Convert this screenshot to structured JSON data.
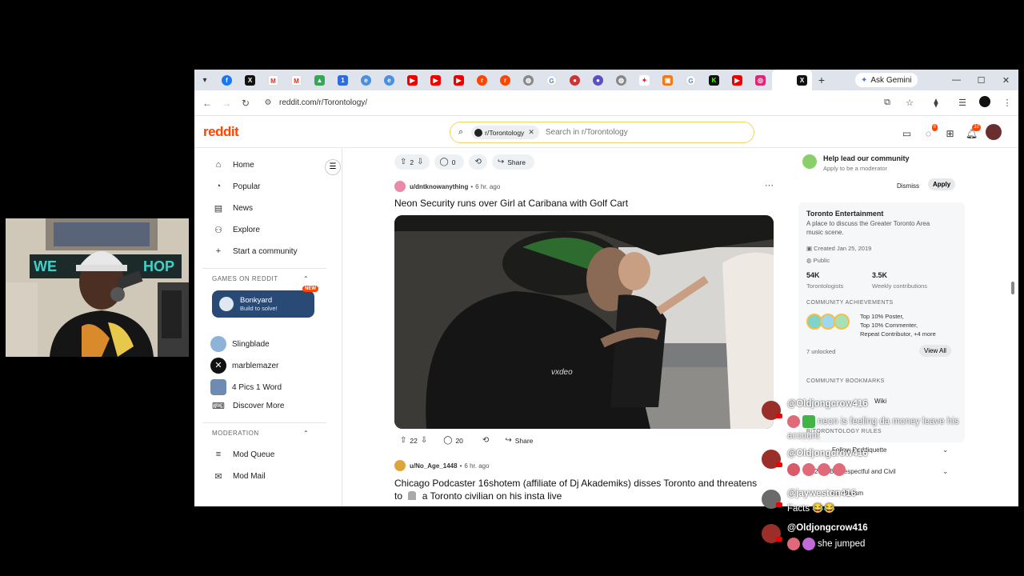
{
  "browser": {
    "tabs_favicons": [
      "facebook",
      "x",
      "gmail",
      "gmail",
      "drive",
      "docs",
      "edge",
      "edge",
      "youtube",
      "youtube",
      "youtube",
      "reddit",
      "reddit",
      "globe",
      "google",
      "record",
      "circle",
      "globe",
      "canada",
      "orange",
      "google",
      "kick",
      "youtube",
      "instagram"
    ],
    "active_tab_icon": "x",
    "new_tab_label": "+",
    "gemini_label": "Ask Gemini",
    "url": "reddit.com/r/Torontology/"
  },
  "reddit": {
    "logo": "reddit",
    "search": {
      "community_chip": "r/Torontology",
      "placeholder": "Search in r/Torontology"
    },
    "chat_badge": "6",
    "notif_badge": "10"
  },
  "leftnav": {
    "items": [
      {
        "label": "Home",
        "icon": "home-icon"
      },
      {
        "label": "Popular",
        "icon": "popular-icon"
      },
      {
        "label": "News",
        "icon": "news-icon"
      },
      {
        "label": "Explore",
        "icon": "explore-icon"
      },
      {
        "label": "Start a community",
        "icon": "plus-icon"
      }
    ],
    "games_header": "GAMES ON REDDIT",
    "featured_game": {
      "title": "Bonkyard",
      "subtitle": "Build to solve!",
      "badge": "NEW"
    },
    "games": [
      "Slingblade",
      "marblemazer",
      "4 Pics 1 Word",
      "Discover More"
    ],
    "moderation_header": "MODERATION",
    "mod_items": [
      "Mod Queue",
      "Mod Mail"
    ]
  },
  "feed": {
    "top_actions": {
      "votes": "2",
      "comments": "0",
      "share": "Share"
    },
    "post1": {
      "author": "u/dntknowanything",
      "time": "6 hr. ago",
      "title": "Neon Security runs over Girl at Caribana with Golf Cart",
      "watermark": "vxdeo",
      "votes": "22",
      "comments": "20",
      "share": "Share"
    },
    "post2": {
      "author": "u/No_Age_1448",
      "time": "6 hr. ago",
      "title_line1": "Chicago Podcaster 16shotem (affiliate of Dj Akademiks) disses Toronto and threatens",
      "title_line2_prefix": "to",
      "title_line2_suffix": "a Toronto civilian on his insta live"
    }
  },
  "sidebar": {
    "help_title": "Help lead our community",
    "help_sub": "Apply to be a moderator",
    "dismiss": "Dismiss",
    "apply": "Apply",
    "community_name": "Toronto Entertainment",
    "community_desc_1": "A place to discuss the Greater Toronto Area",
    "community_desc_2": "music scene.",
    "created": "Created Jan 25, 2019",
    "visibility": "Public",
    "members": "54K",
    "members_label": "Torontologists",
    "contributions": "3.5K",
    "contributions_label": "Weekly contributions",
    "achievements_header": "COMMUNITY ACHIEVEMENTS",
    "ach_1": "Top 10% Poster,",
    "ach_2": "Top 10% Commenter,",
    "ach_3": "Repeat Contributor, +4 more",
    "unlocked": "7 unlocked",
    "view_all": "View All",
    "bookmarks_header": "COMMUNITY BOOKMARKS",
    "wiki": "Wiki",
    "rules_header": "R/TORONTOLOGY RULES",
    "rule_1": "Follow Reddiquette",
    "rule_2_num": "2",
    "rule_2": "Be Respectful and Civil",
    "rule_3": "No Racism"
  },
  "chat": [
    {
      "user": "@Oldjongcrow416",
      "text": "neon is feeling da money leave his",
      "text2": "account"
    },
    {
      "user": "@Oldjongcrow416",
      "text": ""
    },
    {
      "user": "@jayweston416",
      "text": "Facts 😂😂"
    },
    {
      "user": "@Oldjongcrow416",
      "text": "she jumped"
    }
  ],
  "colors": {
    "reddit_orange": "#ff4500",
    "bonkyard_bg": "#2a4a76",
    "search_border": "#f1d36a"
  }
}
